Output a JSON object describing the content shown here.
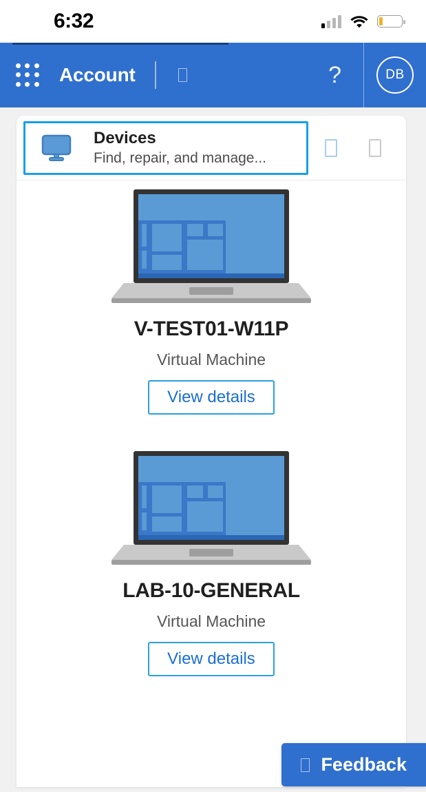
{
  "status_bar": {
    "time": "6:32",
    "signal_icon": "signal-bars-icon",
    "wifi_icon": "wifi-icon",
    "battery_icon": "battery-low-icon",
    "battery_accent": "#f0b323"
  },
  "app_bar": {
    "waffle_icon": "app-launcher-waffle-icon",
    "title": "Account",
    "tofu_glyph": "⎕",
    "help_label": "?",
    "avatar_initials": "DB",
    "background": "#2f6fce",
    "accent_line": "#1b3f7e"
  },
  "section": {
    "icon": "monitor-icon",
    "title": "Devices",
    "subtitle": "Find, repair, and manage...",
    "focus_color": "#18a0e8",
    "action_blue_glyph": "⎕",
    "action_gray_glyph": "⎕"
  },
  "devices": [
    {
      "illustration": "laptop-illustration",
      "name": "V-TEST01-W11P",
      "type": "Virtual Machine",
      "action_label": "View details"
    },
    {
      "illustration": "laptop-illustration",
      "name": "LAB-10-GENERAL",
      "type": "Virtual Machine",
      "action_label": "View details"
    }
  ],
  "feedback": {
    "glyph": "⎕",
    "label": "Feedback",
    "background": "#2f6fce"
  }
}
